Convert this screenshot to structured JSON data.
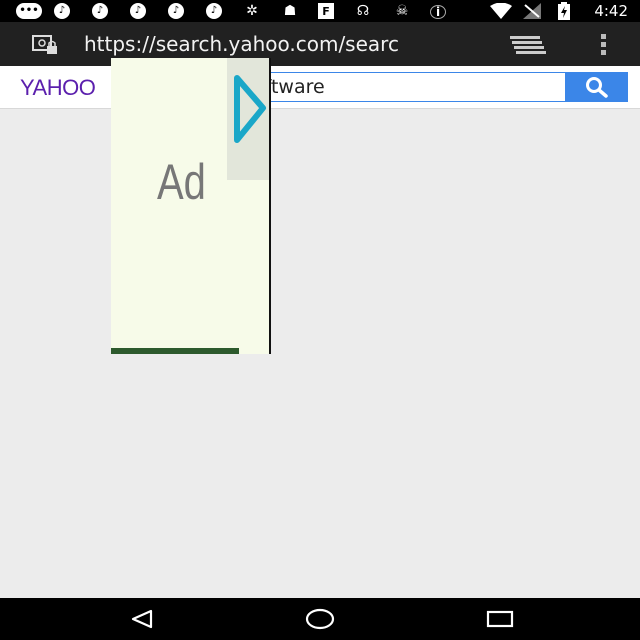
{
  "status_bar": {
    "time": "4:42",
    "left_icons": [
      "chat-icon",
      "music-icon",
      "music-icon",
      "music-icon",
      "music-icon",
      "music-icon",
      "shuffle-icon",
      "android-icon",
      "flipboard-icon",
      "headphones-icon",
      "cat-icon",
      "info-icon"
    ],
    "right_icons": [
      "wifi-icon",
      "signal-icon",
      "battery-charging-icon"
    ]
  },
  "browser": {
    "url": "https://search.yahoo.com/searc",
    "tabs_icon": "tabs-icon",
    "menu_icon": "overflow-menu-icon"
  },
  "yahoo": {
    "logo": "YAHOO",
    "search_value": "oftware",
    "search_icon": "search-icon",
    "accent": "#3b86e8",
    "logo_color": "#5b1fad"
  },
  "ad": {
    "label": "Ad",
    "play_icon": "play-icon",
    "accent": "#1aa7c8"
  },
  "nav": {
    "back": "back-icon",
    "home": "home-icon",
    "recents": "recents-icon"
  }
}
